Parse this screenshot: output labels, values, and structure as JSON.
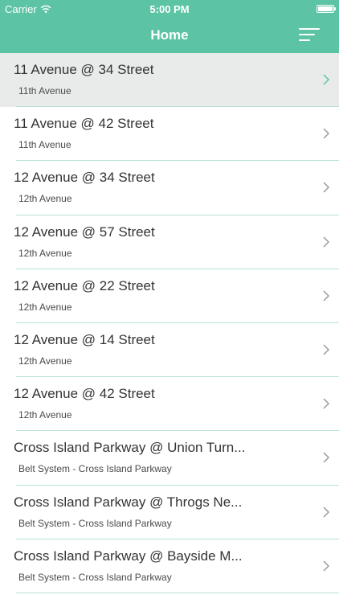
{
  "status_bar": {
    "carrier": "Carrier",
    "time": "5:00 PM",
    "wifi_icon": "wifi-icon",
    "battery_icon": "battery-icon"
  },
  "header": {
    "title": "Home",
    "menu_icon": "menu-sort-icon"
  },
  "colors": {
    "accent": "#5cc4a4",
    "selected_row": "#e9eaea",
    "separator": "#b9e2d4",
    "chevron_default": "#9a9a9a",
    "chevron_selected": "#5cc4a4"
  },
  "list": {
    "items": [
      {
        "title": "11 Avenue @ 34 Street",
        "subtitle": "11th Avenue",
        "selected": true
      },
      {
        "title": "11 Avenue @ 42 Street",
        "subtitle": "11th Avenue",
        "selected": false
      },
      {
        "title": "12 Avenue @ 34 Street",
        "subtitle": "12th Avenue",
        "selected": false
      },
      {
        "title": "12 Avenue @ 57 Street",
        "subtitle": "12th Avenue",
        "selected": false
      },
      {
        "title": "12 Avenue @ 22 Street",
        "subtitle": "12th Avenue",
        "selected": false
      },
      {
        "title": "12 Avenue @ 14 Street",
        "subtitle": "12th Avenue",
        "selected": false
      },
      {
        "title": "12 Avenue @ 42 Street",
        "subtitle": "12th Avenue",
        "selected": false
      },
      {
        "title": "Cross Island Parkway @ Union Turn...",
        "subtitle": "Belt System - Cross Island Parkway",
        "selected": false
      },
      {
        "title": "Cross Island Parkway @ Throgs Ne...",
        "subtitle": "Belt System - Cross Island Parkway",
        "selected": false
      },
      {
        "title": "Cross Island Parkway @ Bayside M...",
        "subtitle": "Belt System - Cross Island Parkway",
        "selected": false
      }
    ]
  }
}
